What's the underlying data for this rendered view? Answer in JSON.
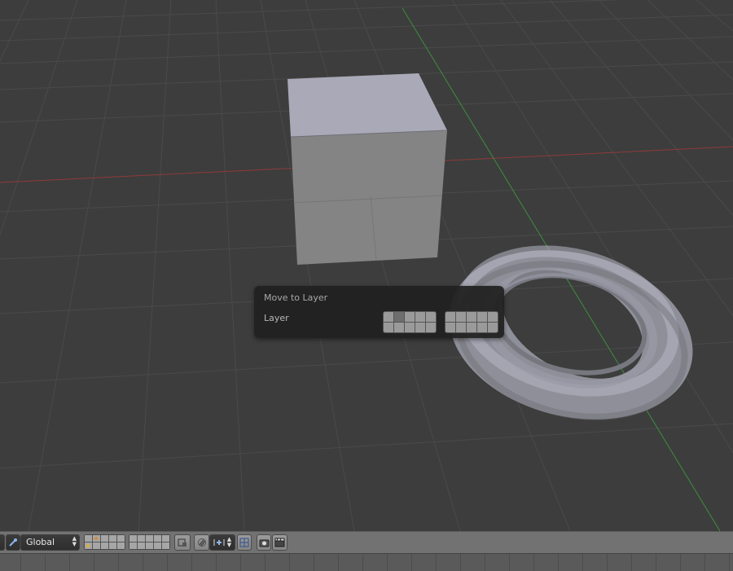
{
  "viewport": {
    "objects": [
      {
        "name": "Cube"
      },
      {
        "name": "Torus"
      }
    ],
    "colors": {
      "background": "#3d3d3d",
      "grid": "#4a4a4a",
      "x_axis": "#8f3a3a",
      "y_axis": "#3d8f3d",
      "mesh_light": "#a9a9b8",
      "mesh_mid": "#828282",
      "mesh_dark": "#6f6f6f"
    }
  },
  "popup": {
    "title": "Move to Layer",
    "layer_label": "Layer",
    "active_layers": [
      1
    ]
  },
  "header": {
    "orientation_value": "Global",
    "icons": [
      "editor-type-icon",
      "pivot-icon",
      "layers-grid-icon",
      "lock-camera-icon",
      "snap-magnet-icon",
      "snap-element-icon",
      "overlay-icon",
      "render-camera-icon",
      "clapboard-icon"
    ],
    "colors": {
      "header_bg": "#727272",
      "button_bg": "#959595",
      "dropdown_bg": "#333333",
      "dropdown_text": "#e8e8e8"
    }
  }
}
